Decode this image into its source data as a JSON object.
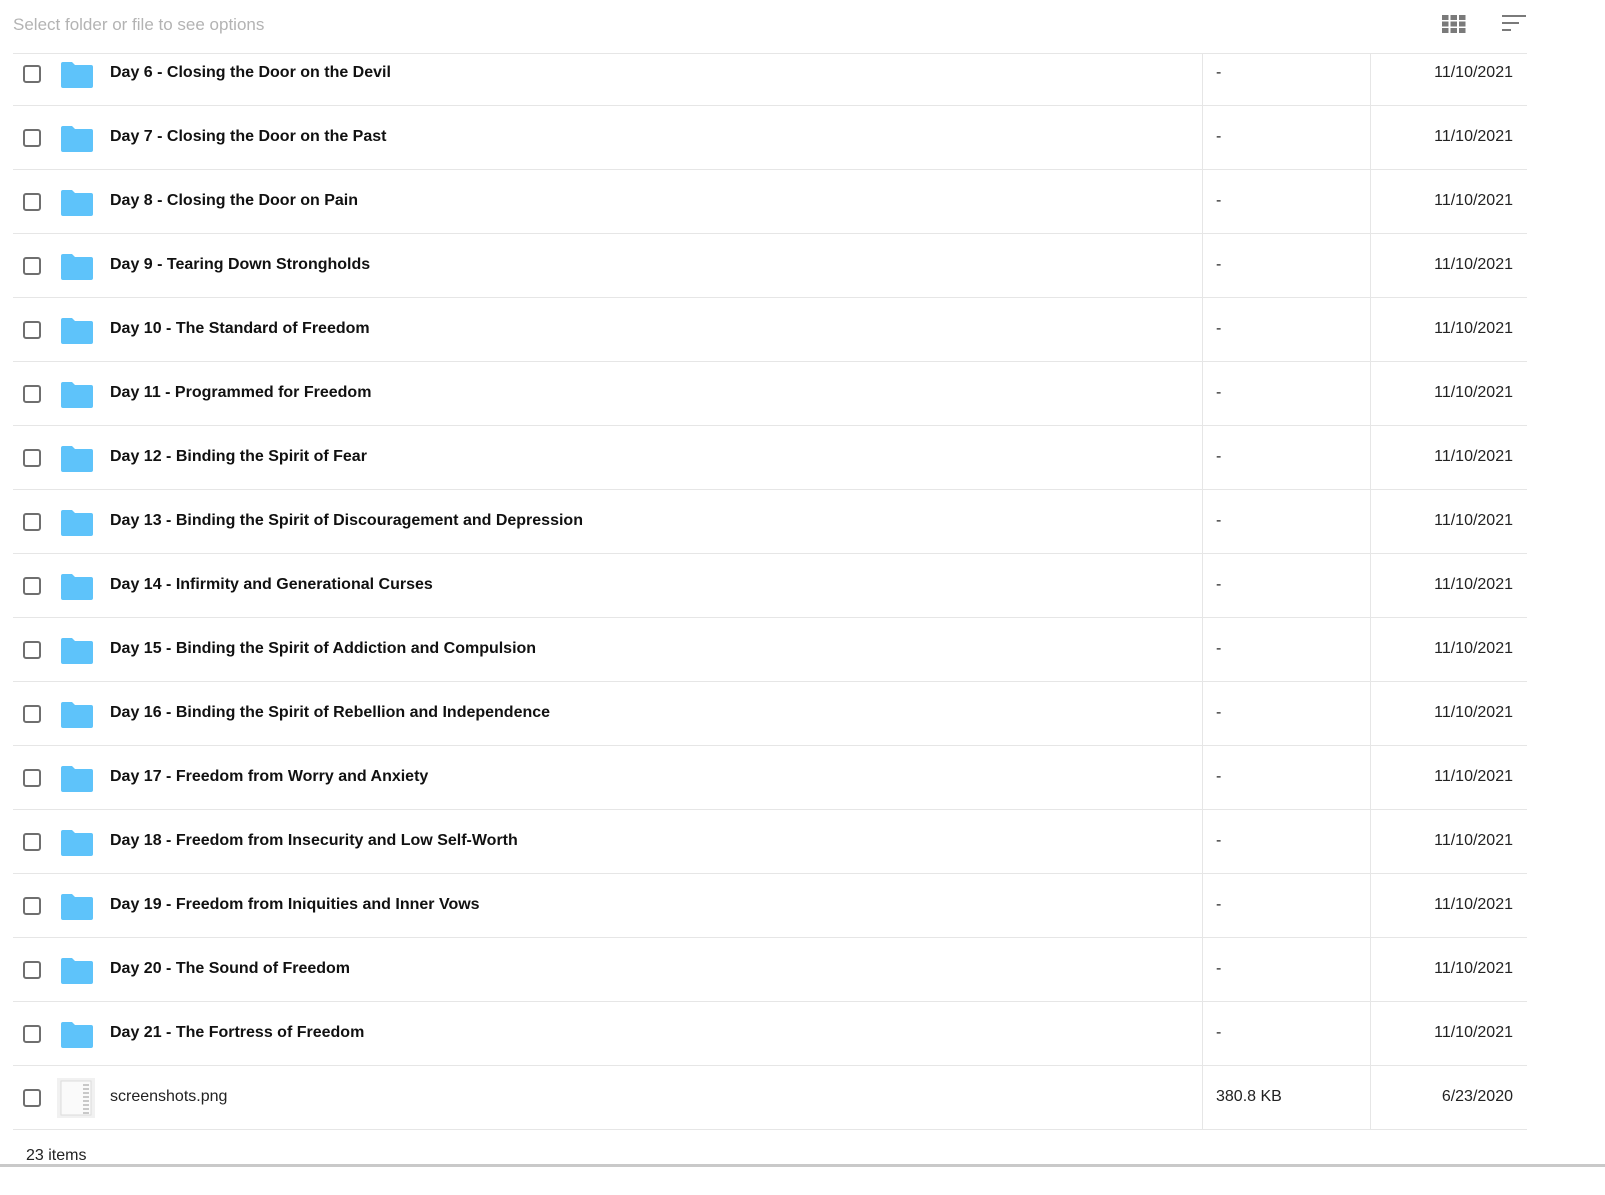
{
  "toolbar": {
    "hint": "Select folder or file to see options",
    "grid_icon": "grid-view-icon",
    "sort_icon": "sort-icon"
  },
  "colors": {
    "folder": "#5ec3fa",
    "divider": "#e6e6e6"
  },
  "items": [
    {
      "name": "Day 6 - Closing the Door on the Devil",
      "size": "-",
      "date": "11/10/2021",
      "type": "folder"
    },
    {
      "name": "Day 7 - Closing the Door on the Past",
      "size": "-",
      "date": "11/10/2021",
      "type": "folder"
    },
    {
      "name": "Day 8 - Closing the Door on Pain",
      "size": "-",
      "date": "11/10/2021",
      "type": "folder"
    },
    {
      "name": "Day 9 - Tearing Down Strongholds",
      "size": "-",
      "date": "11/10/2021",
      "type": "folder"
    },
    {
      "name": "Day 10 - The Standard of Freedom",
      "size": "-",
      "date": "11/10/2021",
      "type": "folder"
    },
    {
      "name": "Day 11 - Programmed for Freedom",
      "size": "-",
      "date": "11/10/2021",
      "type": "folder"
    },
    {
      "name": "Day 12 - Binding the Spirit of Fear",
      "size": "-",
      "date": "11/10/2021",
      "type": "folder"
    },
    {
      "name": "Day 13 - Binding the Spirit of Discouragement and Depression",
      "size": "-",
      "date": "11/10/2021",
      "type": "folder"
    },
    {
      "name": "Day 14 - Infirmity and Generational Curses",
      "size": "-",
      "date": "11/10/2021",
      "type": "folder"
    },
    {
      "name": "Day 15 - Binding the Spirit of Addiction and Compulsion",
      "size": "-",
      "date": "11/10/2021",
      "type": "folder"
    },
    {
      "name": "Day 16 - Binding the Spirit of Rebellion and Independence",
      "size": "-",
      "date": "11/10/2021",
      "type": "folder"
    },
    {
      "name": "Day 17 - Freedom from Worry and Anxiety",
      "size": "-",
      "date": "11/10/2021",
      "type": "folder"
    },
    {
      "name": "Day 18 - Freedom from Insecurity and Low Self-Worth",
      "size": "-",
      "date": "11/10/2021",
      "type": "folder"
    },
    {
      "name": "Day 19 - Freedom from Iniquities and Inner Vows",
      "size": "-",
      "date": "11/10/2021",
      "type": "folder"
    },
    {
      "name": "Day 20 - The Sound of Freedom",
      "size": "-",
      "date": "11/10/2021",
      "type": "folder"
    },
    {
      "name": "Day 21 - The Fortress of Freedom",
      "size": "-",
      "date": "11/10/2021",
      "type": "folder"
    },
    {
      "name": "screenshots.png",
      "size": "380.8 KB",
      "date": "6/23/2020",
      "type": "file"
    }
  ],
  "footer": {
    "count": "23 items"
  }
}
